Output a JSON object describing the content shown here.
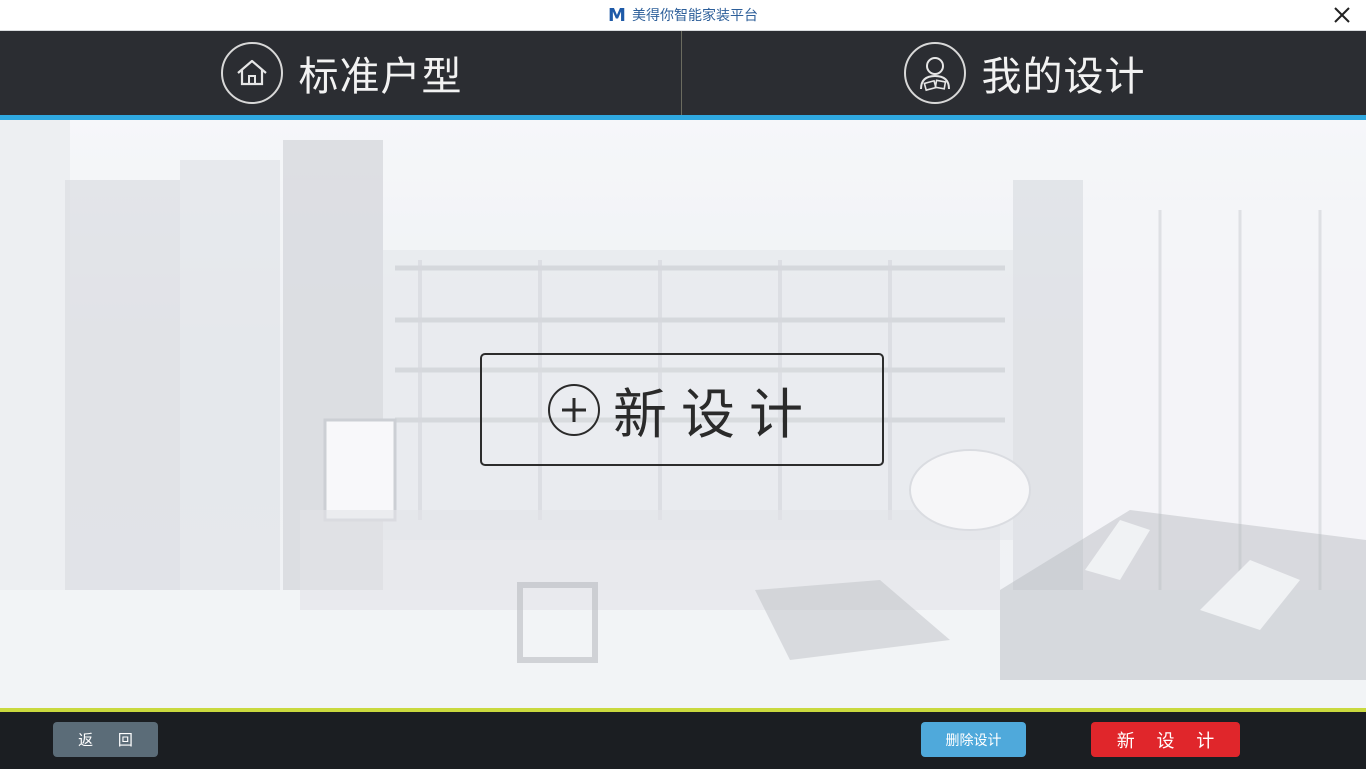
{
  "titlebar": {
    "logo_text": "M",
    "title": "美得你智能家装平台",
    "close_icon": "close-icon"
  },
  "tabs": [
    {
      "label": "标准户型",
      "icon": "house-icon"
    },
    {
      "label": "我的设计",
      "icon": "user-profile-icon"
    }
  ],
  "main": {
    "new_design_label": "新设计",
    "new_design_icon": "plus-circle-icon"
  },
  "footer": {
    "back_label": "返 回",
    "delete_label": "删除设计",
    "new_label": "新 设 计"
  },
  "colors": {
    "accent_blue": "#2fa8e0",
    "accent_yellow": "#c9d93e",
    "danger_red": "#e0262b",
    "header_dark": "#2b2d32",
    "footer_dark": "#1b1e22",
    "brand_blue": "#1e5aa8"
  }
}
